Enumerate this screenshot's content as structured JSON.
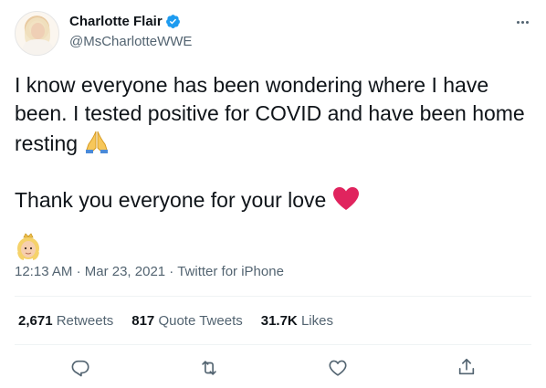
{
  "author": {
    "display_name": "Charlotte Flair",
    "handle": "@MsCharlotteWWE"
  },
  "tweet": {
    "lines": [
      "I know everyone has been wondering where I have",
      "been. I tested positive for COVID and have been home",
      "resting",
      "Thank you everyone for your love"
    ],
    "emoji_pray": "🙏",
    "emoji_heart": "❤️",
    "emoji_princess": "👸🏼"
  },
  "meta": {
    "time": "12:13 AM",
    "sep1": "·",
    "date": "Mar 23, 2021",
    "sep2": "·",
    "source": "Twitter for iPhone"
  },
  "stats": {
    "retweets_count": "2,671",
    "retweets_label": "Retweets",
    "quotes_count": "817",
    "quotes_label": "Quote Tweets",
    "likes_count": "31.7K",
    "likes_label": "Likes"
  },
  "icons": {
    "more": "more-icon",
    "verified": "verified-badge-icon",
    "reply": "reply-icon",
    "retweet": "retweet-icon",
    "like": "like-icon",
    "share": "share-icon"
  },
  "colors": {
    "verified": "#1d9bf0",
    "secondary_text": "#536471",
    "primary_text": "#0f1419",
    "heart": "#e0245e"
  }
}
